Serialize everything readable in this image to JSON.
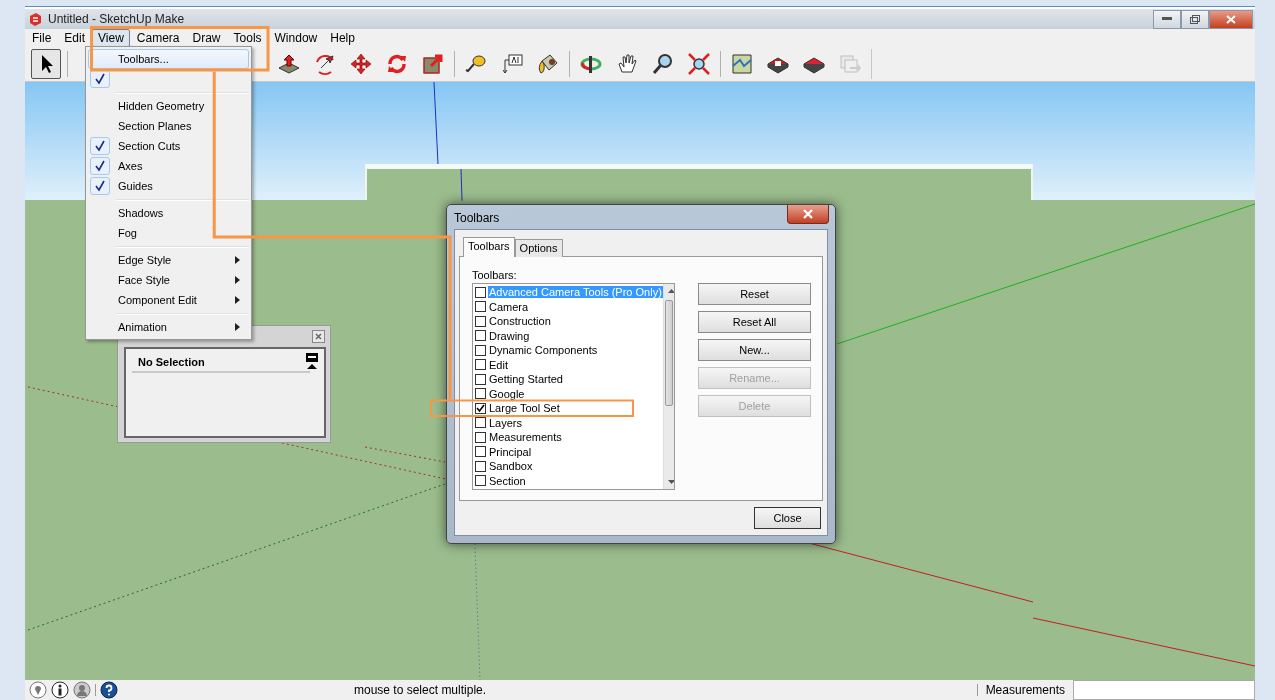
{
  "window": {
    "title": "Untitled - SketchUp Make"
  },
  "menu_bar": [
    {
      "label": "File",
      "selected": false
    },
    {
      "label": "Edit",
      "selected": false
    },
    {
      "label": "View",
      "selected": true
    },
    {
      "label": "Camera",
      "selected": false
    },
    {
      "label": "Draw",
      "selected": false
    },
    {
      "label": "Tools",
      "selected": false
    },
    {
      "label": "Window",
      "selected": false
    },
    {
      "label": "Help",
      "selected": false
    }
  ],
  "toolbar": {
    "groups": [
      {
        "tools": [
          {
            "kind": "select",
            "selected": true,
            "disabled": false
          }
        ]
      },
      {
        "tools": [
          {
            "kind": "push-pull",
            "selected": false,
            "disabled": false
          },
          {
            "kind": "follow-me",
            "selected": false,
            "disabled": false
          },
          {
            "kind": "move",
            "selected": false,
            "disabled": false
          },
          {
            "kind": "rotate",
            "selected": false,
            "disabled": false
          },
          {
            "kind": "scale",
            "selected": false,
            "disabled": false
          }
        ]
      },
      {
        "tools": [
          {
            "kind": "tape",
            "selected": false,
            "disabled": false
          },
          {
            "kind": "text",
            "selected": false,
            "disabled": false
          },
          {
            "kind": "paint",
            "selected": false,
            "disabled": false
          }
        ]
      },
      {
        "tools": [
          {
            "kind": "orbit",
            "selected": false,
            "disabled": false
          },
          {
            "kind": "pan",
            "selected": false,
            "disabled": false
          },
          {
            "kind": "zoom",
            "selected": false,
            "disabled": false
          },
          {
            "kind": "zoom-extents",
            "selected": false,
            "disabled": false
          }
        ]
      },
      {
        "tools": [
          {
            "kind": "map",
            "selected": false,
            "disabled": false
          },
          {
            "kind": "warehouse",
            "selected": false,
            "disabled": false
          },
          {
            "kind": "extension",
            "selected": false,
            "disabled": false
          },
          {
            "kind": "share",
            "selected": false,
            "disabled": true
          }
        ]
      }
    ]
  },
  "view_menu": {
    "groups": [
      {
        "items": [
          {
            "label": "Toolbars...",
            "checked": false,
            "submenu": false,
            "highlighted": true
          },
          {
            "checked": true,
            "submenu": false,
            "highlighted": false
          }
        ]
      },
      {
        "items": [
          {
            "label": "Hidden Geometry",
            "checked": false,
            "submenu": false,
            "highlighted": false
          },
          {
            "label": "Section Planes",
            "checked": false,
            "submenu": false,
            "highlighted": false
          },
          {
            "label": "Section Cuts",
            "checked": true,
            "submenu": false,
            "highlighted": false
          },
          {
            "label": "Axes",
            "checked": true,
            "submenu": false,
            "highlighted": false
          },
          {
            "label": "Guides",
            "checked": true,
            "submenu": false,
            "highlighted": false
          }
        ]
      },
      {
        "items": [
          {
            "label": "Shadows",
            "checked": false,
            "submenu": false,
            "highlighted": false
          },
          {
            "label": "Fog",
            "checked": false,
            "submenu": false,
            "highlighted": false
          }
        ]
      },
      {
        "items": [
          {
            "label": "Edge Style",
            "checked": false,
            "submenu": true,
            "highlighted": false
          },
          {
            "label": "Face Style",
            "checked": false,
            "submenu": true,
            "highlighted": false
          },
          {
            "label": "Component Edit",
            "checked": false,
            "submenu": true,
            "highlighted": false
          }
        ]
      },
      {
        "items": [
          {
            "label": "Animation",
            "checked": false,
            "submenu": true,
            "highlighted": false
          }
        ]
      }
    ]
  },
  "entity_info": {
    "selection": "No Selection"
  },
  "toolbars_dialog": {
    "title": "Toolbars",
    "tabs": [
      {
        "label": "Toolbars",
        "selected": true
      },
      {
        "label": "Options",
        "selected": false
      }
    ],
    "list_label": "Toolbars:",
    "items": [
      {
        "label": "Advanced Camera Tools (Pro Only)",
        "checked": false,
        "selected": true
      },
      {
        "label": "Camera",
        "checked": false,
        "selected": false
      },
      {
        "label": "Construction",
        "checked": false,
        "selected": false
      },
      {
        "label": "Drawing",
        "checked": false,
        "selected": false
      },
      {
        "label": "Dynamic Components",
        "checked": false,
        "selected": false
      },
      {
        "label": "Edit",
        "checked": false,
        "selected": false
      },
      {
        "label": "Getting Started",
        "checked": false,
        "selected": false
      },
      {
        "label": "Google",
        "checked": false,
        "selected": false
      },
      {
        "label": "Large Tool Set",
        "checked": true,
        "selected": false
      },
      {
        "label": "Layers",
        "checked": false,
        "selected": false
      },
      {
        "label": "Measurements",
        "checked": false,
        "selected": false
      },
      {
        "label": "Principal",
        "checked": false,
        "selected": false
      },
      {
        "label": "Sandbox",
        "checked": false,
        "selected": false
      },
      {
        "label": "Section",
        "checked": false,
        "selected": false
      }
    ],
    "buttons": [
      {
        "label": "Reset",
        "disabled": false
      },
      {
        "label": "Reset All",
        "disabled": false
      },
      {
        "label": "New...",
        "disabled": false
      },
      {
        "label": "Rename...",
        "disabled": true
      },
      {
        "label": "Delete",
        "disabled": true
      }
    ],
    "close_button": "Close"
  },
  "status_bar": {
    "hint": "mouse to select multiple.",
    "measurements_label": "Measurements"
  }
}
